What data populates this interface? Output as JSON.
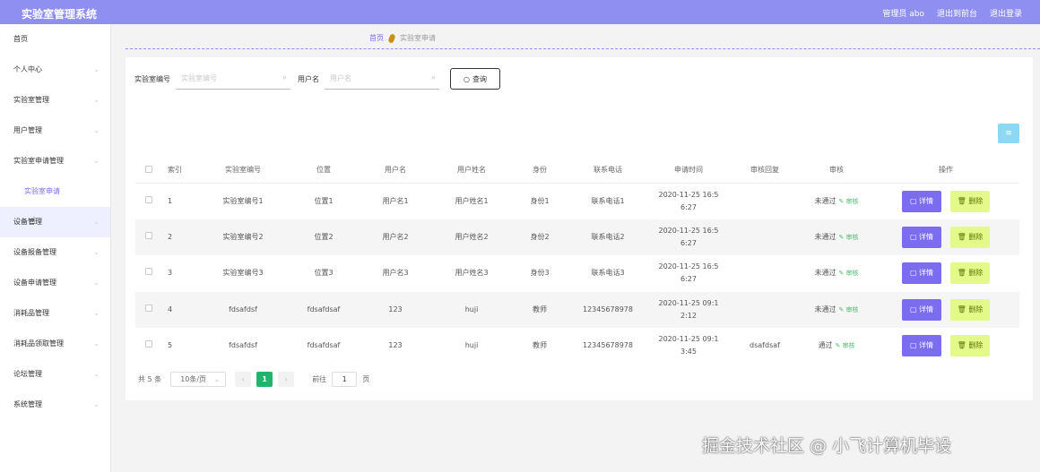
{
  "header": {
    "title": "实验室管理系统",
    "user": "管理员 abo",
    "to_front": "退出到前台",
    "logout": "退出登录"
  },
  "sidebar": {
    "items": [
      {
        "label": "首页",
        "chevron": false
      },
      {
        "label": "个人中心",
        "chevron": true
      },
      {
        "label": "实验室管理",
        "chevron": true
      },
      {
        "label": "用户管理",
        "chevron": true
      },
      {
        "label": "实验室申请管理",
        "chevron": true
      },
      {
        "label": "实验室申请",
        "chevron": false,
        "sub": true
      },
      {
        "label": "设备管理",
        "chevron": true
      },
      {
        "label": "设备报备管理",
        "chevron": true
      },
      {
        "label": "设备申请管理",
        "chevron": true
      },
      {
        "label": "消耗品管理",
        "chevron": true
      },
      {
        "label": "消耗品领取管理",
        "chevron": true
      },
      {
        "label": "论坛管理",
        "chevron": true
      },
      {
        "label": "系统管理",
        "chevron": true
      }
    ]
  },
  "breadcrumb": {
    "home": "首页",
    "current": "实验室申请"
  },
  "search": {
    "lab_label": "实验室编号",
    "lab_placeholder": "实验室编号",
    "user_label": "用户名",
    "user_placeholder": "用户名",
    "button": "查询"
  },
  "add_button": "≡",
  "table": {
    "headers": [
      "",
      "索引",
      "实验室编号",
      "位置",
      "用户名",
      "用户姓名",
      "身份",
      "联系电话",
      "申请时间",
      "审核回复",
      "审核",
      "操作"
    ],
    "review_link": "审核",
    "detail_label": "详情",
    "delete_label": "删除",
    "rows": [
      {
        "index": "1",
        "lab": "实验室编号1",
        "location": "位置1",
        "username": "用户名1",
        "name": "用户姓名1",
        "identity": "身份1",
        "phone": "联系电话1",
        "time": "2020-11-25 16:56:27",
        "reply": "",
        "status": "未通过"
      },
      {
        "index": "2",
        "lab": "实验室编号2",
        "location": "位置2",
        "username": "用户名2",
        "name": "用户姓名2",
        "identity": "身份2",
        "phone": "联系电话2",
        "time": "2020-11-25 16:56:27",
        "reply": "",
        "status": "未通过"
      },
      {
        "index": "3",
        "lab": "实验室编号3",
        "location": "位置3",
        "username": "用户名3",
        "name": "用户姓名3",
        "identity": "身份3",
        "phone": "联系电话3",
        "time": "2020-11-25 16:56:27",
        "reply": "",
        "status": "未通过"
      },
      {
        "index": "4",
        "lab": "fdsafdsf",
        "location": "fdsafdsaf",
        "username": "123",
        "name": "huji",
        "identity": "教师",
        "phone": "12345678978",
        "time": "2020-11-25 09:12:12",
        "reply": "",
        "status": "未通过"
      },
      {
        "index": "5",
        "lab": "fdsafdsf",
        "location": "fdsafdsaf",
        "username": "123",
        "name": "huji",
        "identity": "教师",
        "phone": "12345678978",
        "time": "2020-11-25 09:13:45",
        "reply": "dsafdsaf",
        "status": "通过"
      }
    ]
  },
  "pager": {
    "total": "共 5 条",
    "page_size": "10条/页",
    "current_page": "1",
    "goto_label": "前往",
    "goto_value": "1",
    "page_unit": "页"
  },
  "watermark": "掘金技术社区 @ 小飞计算机毕设",
  "colors": {
    "topbar": "#8f8ff2",
    "accent": "#7b6cf0",
    "delete": "#e3f98a",
    "page_active": "#21b46a"
  }
}
